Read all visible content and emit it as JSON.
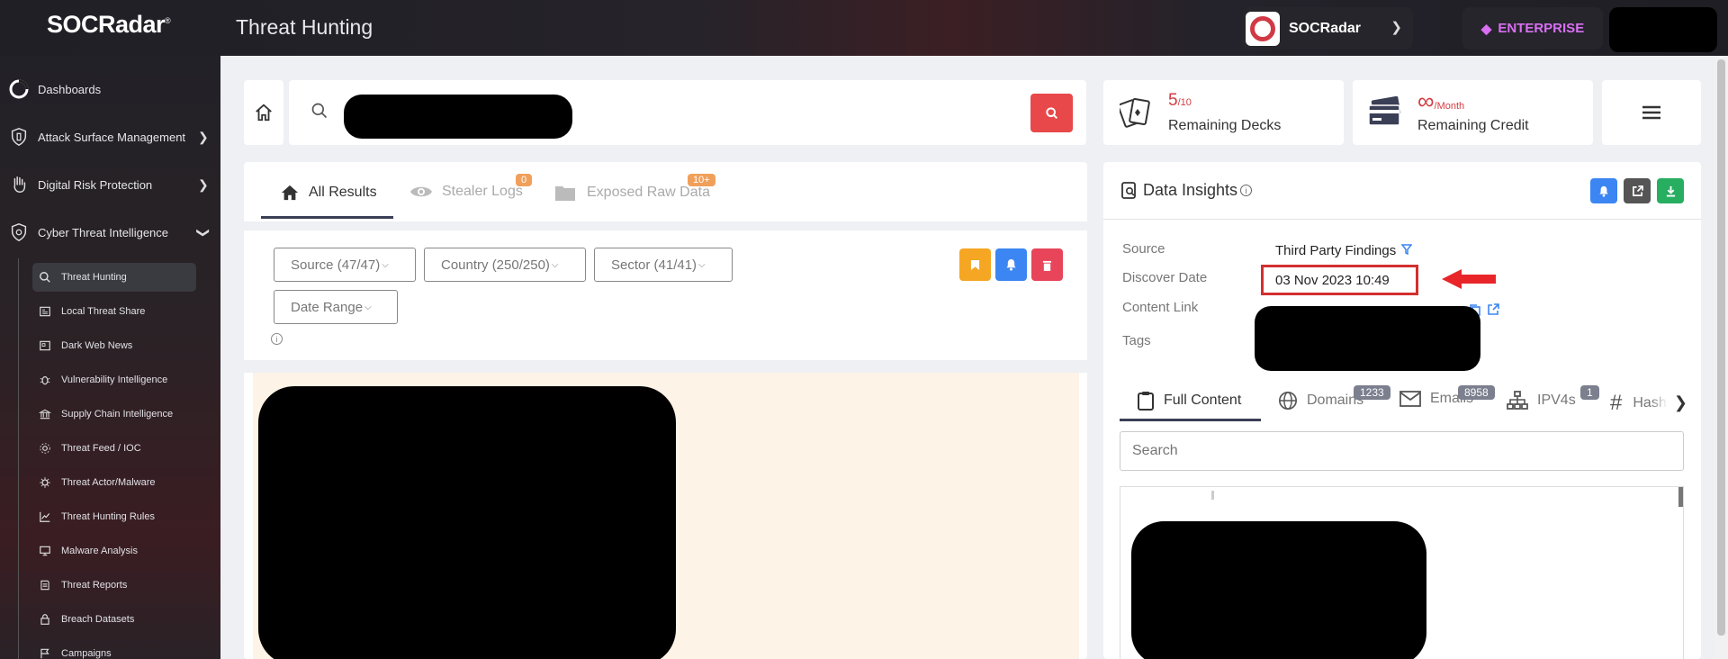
{
  "app": {
    "logo": "SOCRadar",
    "logo_mark": "®",
    "page_title": "Threat Hunting"
  },
  "header": {
    "org_name": "SOCRadar",
    "plan_label": "ENTERPRISE"
  },
  "sidebar": {
    "items": [
      {
        "label": "Dashboards"
      },
      {
        "label": "Attack Surface Management"
      },
      {
        "label": "Digital Risk Protection"
      },
      {
        "label": "Cyber Threat Intelligence"
      }
    ],
    "subitems": [
      {
        "label": "Threat Hunting"
      },
      {
        "label": "Local Threat Share"
      },
      {
        "label": "Dark Web News"
      },
      {
        "label": "Vulnerability Intelligence"
      },
      {
        "label": "Supply Chain Intelligence"
      },
      {
        "label": "Threat Feed / IOC"
      },
      {
        "label": "Threat Actor/Malware"
      },
      {
        "label": "Threat Hunting Rules"
      },
      {
        "label": "Malware Analysis"
      },
      {
        "label": "Threat Reports"
      },
      {
        "label": "Breach Datasets"
      },
      {
        "label": "Campaigns"
      }
    ]
  },
  "stats": {
    "decks": {
      "value": "5",
      "max": "/10",
      "label": "Remaining Decks"
    },
    "credit": {
      "value": "∞",
      "unit": "/Month",
      "label": "Remaining Credit"
    }
  },
  "results": {
    "tabs": [
      {
        "label": "All Results",
        "badge": ""
      },
      {
        "label": "Stealer Logs",
        "badge": "0"
      },
      {
        "label": "Exposed Raw Data",
        "badge": "10+"
      }
    ],
    "filters": [
      {
        "label": "Source (47/47)"
      },
      {
        "label": "Country (250/250)"
      },
      {
        "label": "Sector (41/41)"
      },
      {
        "label": "Date Range"
      }
    ]
  },
  "insights": {
    "title": "Data Insights",
    "fields": {
      "source_label": "Source",
      "source_value": "Third Party Findings",
      "date_label": "Discover Date",
      "date_value": "03 Nov 2023 10:49",
      "link_label": "Content Link",
      "tags_label": "Tags"
    },
    "tabs": [
      {
        "label": "Full Content",
        "badge": ""
      },
      {
        "label": "Domains",
        "badge": "1233"
      },
      {
        "label": "Emails",
        "badge": "8958"
      },
      {
        "label": "IPV4s",
        "badge": "1"
      },
      {
        "label": "Hashes",
        "badge": ""
      }
    ],
    "search_placeholder": "Search"
  },
  "colors": {
    "accent_red": "#e84849",
    "orange": "#f5a623",
    "blue": "#3b86f2",
    "pink": "#e8455a",
    "green": "#27ae60",
    "highlight": "#d32f2f"
  }
}
